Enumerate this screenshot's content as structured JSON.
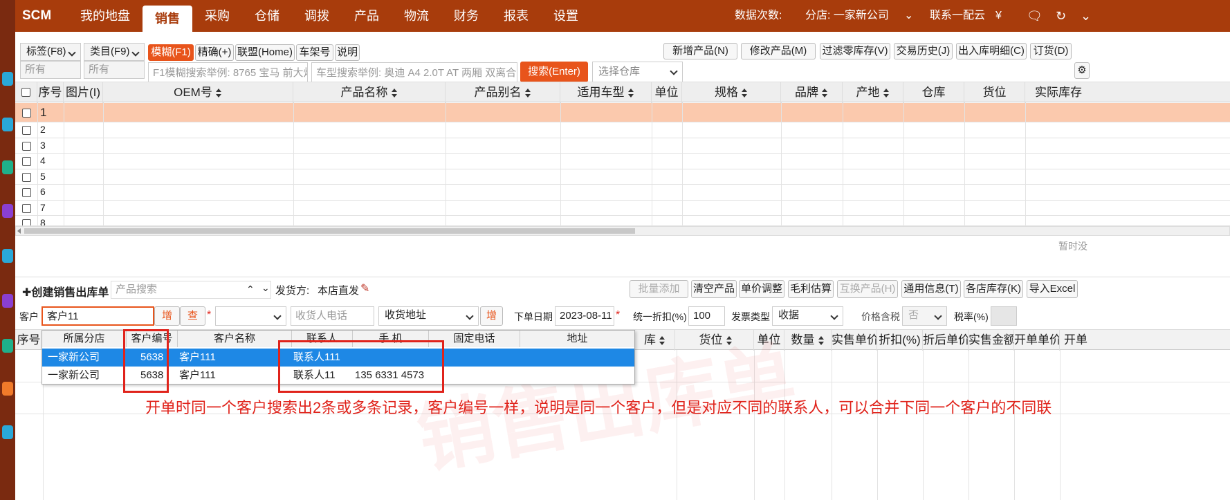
{
  "app": {
    "logo": "SCM"
  },
  "nav": [
    "我的地盘",
    "销售",
    "采购",
    "仓储",
    "调拨",
    "产品",
    "物流",
    "财务",
    "报表",
    "设置"
  ],
  "topright": {
    "data_count": "数据次数:",
    "branch": "分店: 一家新公司",
    "contact": "联系一配云",
    "currency": "¥"
  },
  "filter": {
    "tag_label": "标签(F8)",
    "tag_value": "所有",
    "cat_label": "类目(F9)",
    "cat_value": "所有"
  },
  "modes": [
    "模糊(F1)",
    "精确(+)",
    "联盟(Home)",
    "车架号",
    "说明"
  ],
  "actions": [
    "新增产品(N)",
    "修改产品(M)",
    "过滤零库存(V)",
    "交易历史(J)",
    "出入库明细(C)",
    "订货(D)"
  ],
  "search": {
    "placeholder1": "F1模糊搜索举例: 8765 宝马 前大灯",
    "placeholder2": "车型搜索举例: 奥迪 A4 2.0T AT 两厢 双离合",
    "button": "搜索(Enter)",
    "warehouse": "选择仓库"
  },
  "grid": {
    "headers": [
      "序号",
      "图片(I)",
      "OEM号",
      "产品名称",
      "产品别名",
      "适用车型",
      "单位",
      "规格",
      "品牌",
      "产地",
      "仓库",
      "货位",
      "实际库存"
    ],
    "rows": [
      "1",
      "2",
      "3",
      "4",
      "5",
      "6",
      "7",
      "8"
    ],
    "empty": "暂时没"
  },
  "order": {
    "title": "创建销售出库单",
    "product_search": "产品搜索",
    "ship_label": "发货方:",
    "ship_value": "本店直发",
    "buttons": [
      "批量添加",
      "清空产品",
      "单价调整",
      "毛利估算",
      "互换产品(H)",
      "通用信息(T)",
      "各店库存(K)",
      "导入Excel"
    ]
  },
  "customer": {
    "label": "客户",
    "value": "客户11",
    "add": "增",
    "query": "查",
    "phone_ph": "收货人电话",
    "addr_ph": "收货地址",
    "add2": "增",
    "date_label": "下单日期",
    "date": "2023-08-11",
    "discount_label": "统一折扣(%)",
    "discount": "100",
    "invoice_label": "发票类型",
    "invoice": "收据",
    "tax_incl_label": "价格含税",
    "tax_incl": "否",
    "tax_rate_label": "税率(%)"
  },
  "lower_grid": {
    "headers": [
      "库",
      "货位",
      "单位",
      "数量",
      "实售单价",
      "折扣(%)",
      "折后单价",
      "实售金额",
      "开单单价",
      "开单"
    ],
    "seq": "序号"
  },
  "popup": {
    "headers": [
      "所属分店",
      "客户编号",
      "客户名称",
      "联系人",
      "手 机",
      "固定电话",
      "地址"
    ],
    "rows": [
      {
        "branch": "一家新公司",
        "code": "5638",
        "name": "客户111",
        "contact": "联系人111",
        "mobile": ""
      },
      {
        "branch": "一家新公司",
        "code": "5638",
        "name": "客户111",
        "contact": "联系人11",
        "mobile": "135 6331 4573"
      }
    ]
  },
  "annotation": "开单时同一个客户搜索出2条或多条记录，客户编号一样，说明是同一个客户，但是对应不同的联系人，可以合并下同一个客户的不同联",
  "watermark": "销售出库单"
}
